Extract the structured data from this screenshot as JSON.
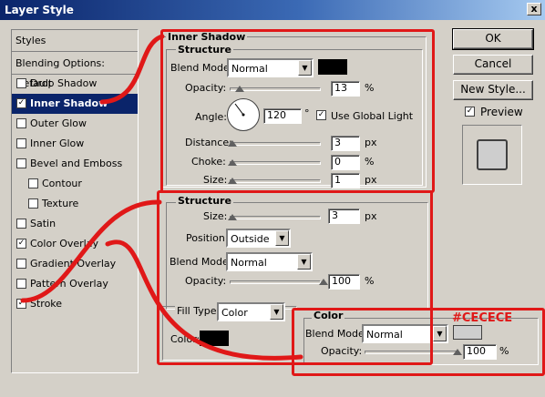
{
  "window": {
    "title": "Layer Style",
    "close_glyph": "x"
  },
  "sidebar": {
    "items": [
      {
        "label": "Styles",
        "checkbox": false,
        "checked": false
      },
      {
        "label": "Blending Options: Default",
        "checkbox": false,
        "checked": false
      },
      {
        "label": "Drop Shadow",
        "checkbox": true,
        "checked": false
      },
      {
        "label": "Inner Shadow",
        "checkbox": true,
        "checked": true,
        "selected": true
      },
      {
        "label": "Outer Glow",
        "checkbox": true,
        "checked": false
      },
      {
        "label": "Inner Glow",
        "checkbox": true,
        "checked": false
      },
      {
        "label": "Bevel and Emboss",
        "checkbox": true,
        "checked": false
      },
      {
        "label": "Contour",
        "checkbox": true,
        "checked": false
      },
      {
        "label": "Texture",
        "checkbox": true,
        "checked": false
      },
      {
        "label": "Satin",
        "checkbox": true,
        "checked": false
      },
      {
        "label": "Color Overlay",
        "checkbox": true,
        "checked": true
      },
      {
        "label": "Gradient Overlay",
        "checkbox": true,
        "checked": false
      },
      {
        "label": "Pattern Overlay",
        "checkbox": true,
        "checked": false
      },
      {
        "label": "Stroke",
        "checkbox": true,
        "checked": true
      }
    ]
  },
  "inner_shadow": {
    "title": "Inner Shadow",
    "structure_title": "Structure",
    "blend_mode_label": "Blend Mode:",
    "blend_mode": "Normal",
    "shadow_color": "#000000",
    "opacity_label": "Opacity:",
    "opacity": "13",
    "opacity_unit": "%",
    "angle_label": "Angle:",
    "angle": "120",
    "angle_unit": "°",
    "global_light_label": "Use Global Light",
    "global_light_checked": true,
    "distance_label": "Distance:",
    "distance": "3",
    "distance_unit": "px",
    "choke_label": "Choke:",
    "choke": "0",
    "choke_unit": "%",
    "size_label": "Size:",
    "size": "1",
    "size_unit": "px"
  },
  "stroke": {
    "structure_title": "Structure",
    "size_label": "Size:",
    "size": "3",
    "size_unit": "px",
    "position_label": "Position:",
    "position": "Outside",
    "blend_mode_label": "Blend Mode:",
    "blend_mode": "Normal",
    "opacity_label": "Opacity:",
    "opacity": "100",
    "opacity_unit": "%",
    "fill_type_label": "Fill Type:",
    "fill_type": "Color",
    "color_label": "Color:",
    "color": "#000000"
  },
  "color_overlay": {
    "title": "Color",
    "annotation": "#CECECE",
    "blend_mode_label": "Blend Mode:",
    "blend_mode": "Normal",
    "color": "#cecece",
    "opacity_label": "Opacity:",
    "opacity": "100",
    "opacity_unit": "%"
  },
  "buttons": {
    "ok": "OK",
    "cancel": "Cancel",
    "new_style": "New Style...",
    "preview": "Preview",
    "preview_checked": true
  },
  "colors": {
    "annotation_red": "#e01818",
    "selection": "#0a246a",
    "preview_swatch": "#cecece"
  }
}
